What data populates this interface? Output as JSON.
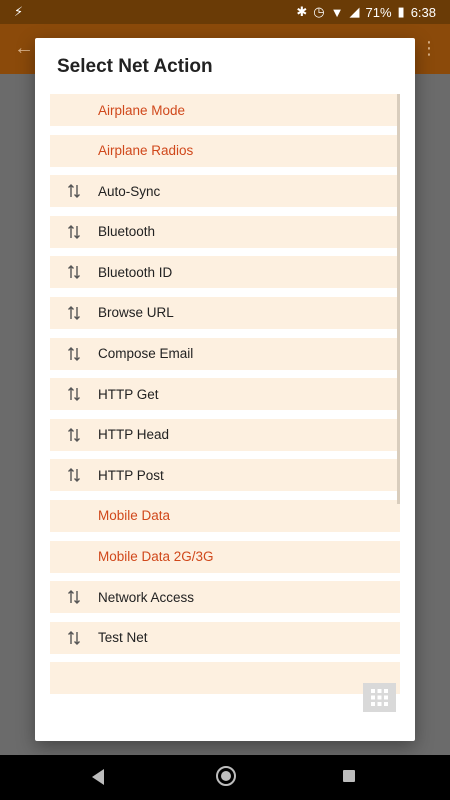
{
  "status_bar": {
    "battery": "71%",
    "time": "6:38"
  },
  "dialog": {
    "title": "Select Net Action",
    "items": [
      {
        "label": "Airplane Mode",
        "icon": "",
        "available": false
      },
      {
        "label": "Airplane Radios",
        "icon": "",
        "available": false
      },
      {
        "label": "Auto-Sync",
        "icon": "swap-vert-icon",
        "available": true
      },
      {
        "label": "Bluetooth",
        "icon": "swap-vert-icon",
        "available": true
      },
      {
        "label": "Bluetooth ID",
        "icon": "swap-vert-icon",
        "available": true
      },
      {
        "label": "Browse URL",
        "icon": "swap-vert-icon",
        "available": true
      },
      {
        "label": "Compose Email",
        "icon": "swap-vert-icon",
        "available": true
      },
      {
        "label": "HTTP Get",
        "icon": "swap-vert-icon",
        "available": true
      },
      {
        "label": "HTTP Head",
        "icon": "swap-vert-icon",
        "available": true
      },
      {
        "label": "HTTP Post",
        "icon": "swap-vert-icon",
        "available": true
      },
      {
        "label": "Mobile Data",
        "icon": "",
        "available": false
      },
      {
        "label": "Mobile Data 2G/3G",
        "icon": "",
        "available": false
      },
      {
        "label": "Network Access",
        "icon": "swap-vert-icon",
        "available": true
      },
      {
        "label": "Test Net",
        "icon": "swap-vert-icon",
        "available": true
      },
      {
        "label": "",
        "icon": "",
        "available": true
      }
    ]
  },
  "colors": {
    "disabled_text": "#d0481b",
    "item_background": "#fdf0e0",
    "app_bar": "#8b4a0a"
  }
}
